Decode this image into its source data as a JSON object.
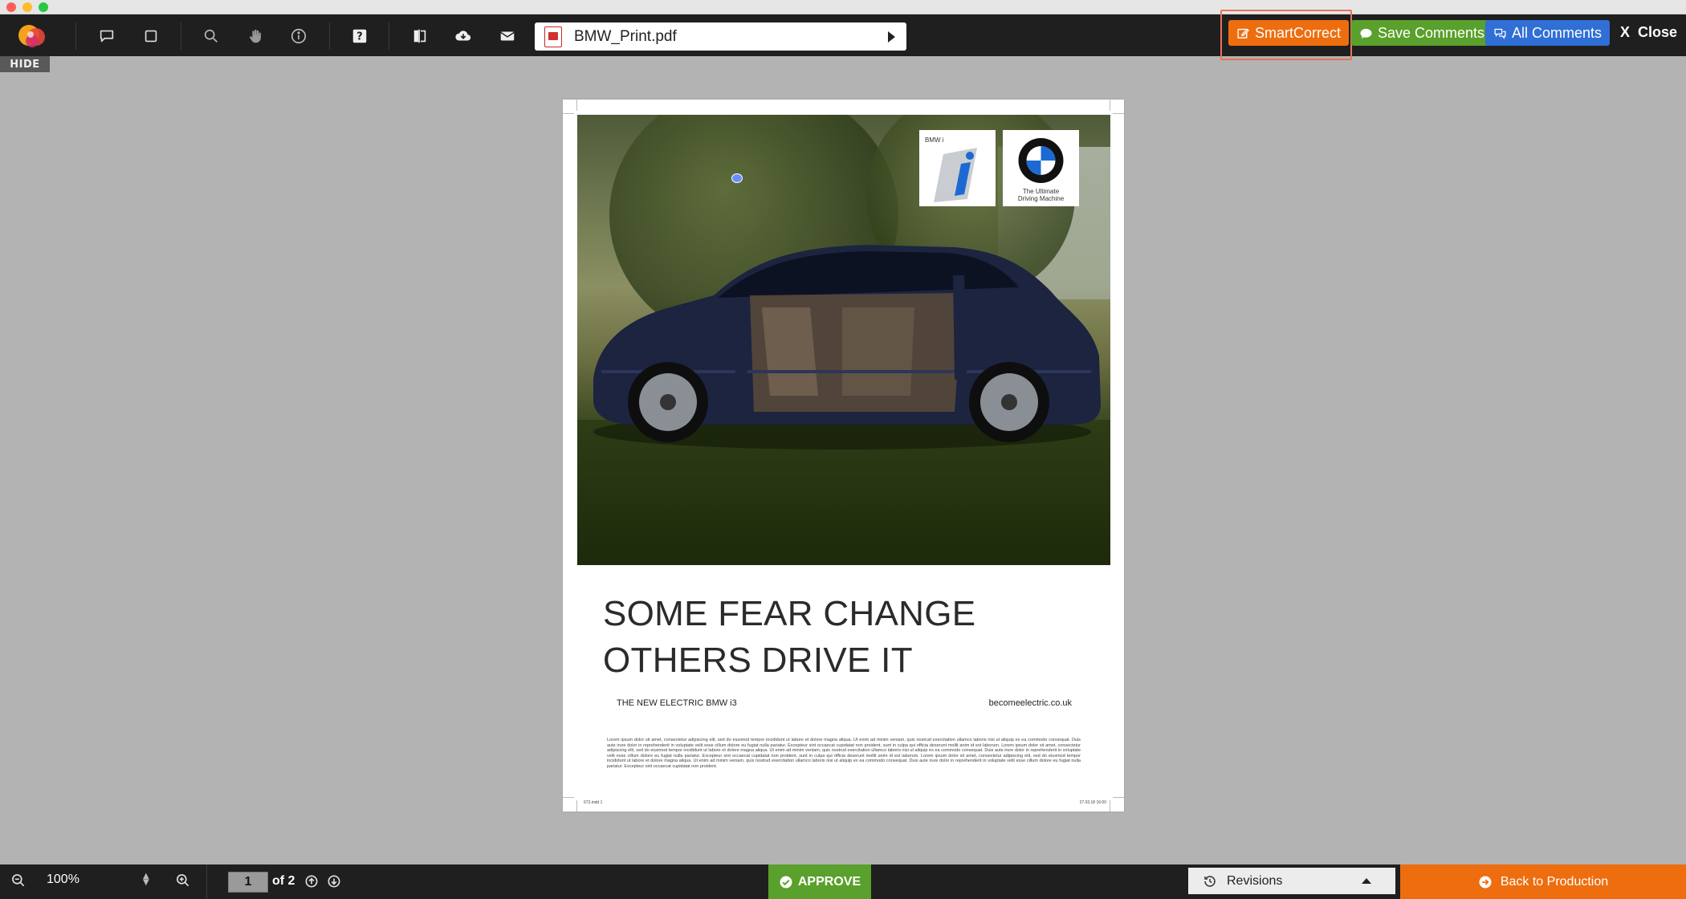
{
  "colors": {
    "toolbar_bg": "#1f1f1f",
    "canvas_bg": "#b3b3b3",
    "smartcorrect": "#ee6d0f",
    "save_comments": "#5aa02c",
    "all_comments": "#2f6fd6",
    "approve": "#5aa02c",
    "back_to_production": "#ee6d0f",
    "highlight_outline": "#e8735a"
  },
  "toolbar": {
    "icons": [
      "app-logo-icon",
      "comment-icon",
      "rectangle-icon",
      "search-icon",
      "hand-icon",
      "info-icon",
      "help-icon",
      "compare-icon",
      "cloud-download-icon",
      "envelope-icon"
    ],
    "file_name": "BMW_Print.pdf",
    "smartcorrect_label": "SmartCorrect",
    "save_comments_label": "Save Comments",
    "all_comments_label": "All Comments",
    "close_x": "X",
    "close_label": "Close"
  },
  "sidebar": {
    "hide_label": "HIDE"
  },
  "document": {
    "logo_left_label": "BMW i",
    "logo_right_tagline_1": "The Ultimate",
    "logo_right_tagline_2": "Driving Machine",
    "headline_line1": "SOME FEAR CHANGE",
    "headline_line2": "OTHERS DRIVE IT",
    "subline_left": "THE NEW ELECTRIC BMW i3",
    "subline_right": "becomeelectric.co.uk",
    "body_text": "Lorem ipsum dolor sit amet, consectetur adipiscing elit, sed do eiusmod tempor incididunt ut labore et dolore magna aliqua. Ut enim ad minim veniam, quis nostrud exercitation ullamco laboris nisi ut aliquip ex ea commodo consequat. Duis aute irure dolor in reprehenderit in voluptate velit esse cillum dolore eu fugiat nulla pariatur. Excepteur sint occaecat cupidatat non proident, sunt in culpa qui officia deserunt mollit anim id est laborum. Lorem ipsum dolor sit amet, consectetur adipiscing elit, sed do eiusmod tempor incididunt ut labore et dolore magna aliqua. Ut enim ad minim veniam, quis nostrud exercitation ullamco laboris nisi ut aliquip ex ea commodo consequat. Duis aute irure dolor in reprehenderit in voluptate velit esse cillum dolore eu fugiat nulla pariatur. Excepteur sint occaecat cupidatat non proident, sunt in culpa qui officia deserunt mollit anim id est laborum. Lorem ipsum dolor sit amet, consectetur adipiscing elit, sed do eiusmod tempor incididunt ut labore et dolore magna aliqua. Ut enim ad minim veniam, quis nostrud exercitation ullamco laboris nisi ut aliquip ex ea commodo consequat. Duis aute irure dolor in reprehenderit in voluptate velit esse cillum dolore eu fugiat nulla pariatur. Excepteur sint occaecat cupidatat non proident.",
    "footer_left": "673.indd 1",
    "footer_right": "27.03.18 16:00"
  },
  "bottombar": {
    "zoom_level": "100%",
    "current_page": "1",
    "page_of": "of 2",
    "approve_label": "APPROVE",
    "revisions_label": "Revisions",
    "back_to_production_label": "Back to Production"
  }
}
